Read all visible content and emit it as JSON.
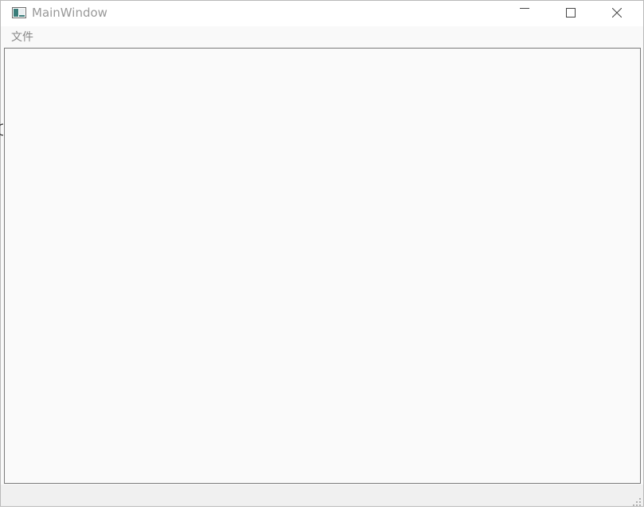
{
  "window": {
    "title": "MainWindow",
    "icon": "app-window-icon",
    "controls": [
      "minimize-icon",
      "maximize-icon",
      "close-icon"
    ]
  },
  "menubar": {
    "items": [
      {
        "label": "文件"
      }
    ]
  },
  "colors": {
    "title_text": "#999999",
    "menu_text": "#888888",
    "window_bg": "#f9f9f9",
    "statusbar_bg": "#f0f0f0",
    "central_border": "#7a7a7a"
  }
}
